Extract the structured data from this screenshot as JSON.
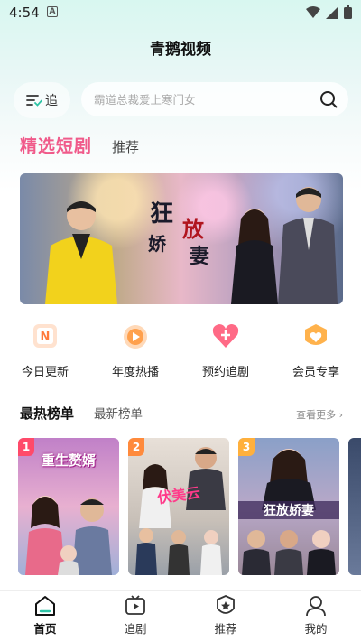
{
  "status": {
    "time": "4:54",
    "notif_glyph": "A"
  },
  "app": {
    "title": "青鹅视频"
  },
  "header": {
    "follow_label": "追",
    "search_placeholder": "霸道总裁爱上寒门女"
  },
  "tabs": [
    {
      "label": "精选短剧",
      "active": true
    },
    {
      "label": "推荐",
      "active": false
    }
  ],
  "banner": {
    "title_chars": [
      "狂",
      "娇",
      "放",
      "妻"
    ]
  },
  "quick_links": [
    {
      "label": "今日更新",
      "icon": "n-calendar-icon",
      "color": "#ff8a4c"
    },
    {
      "label": "年度热播",
      "icon": "play-icon",
      "color": "#ff9a3c"
    },
    {
      "label": "预约追剧",
      "icon": "heart-plus-icon",
      "color": "#ff5a7a"
    },
    {
      "label": "会员专享",
      "icon": "crown-heart-icon",
      "color": "#ffa23c"
    }
  ],
  "ranking": {
    "tabs": [
      {
        "label": "最热榜单",
        "active": true
      },
      {
        "label": "最新榜单",
        "active": false
      }
    ],
    "see_more": "查看更多 ›",
    "cards": [
      {
        "rank": "1",
        "badge_color": "#ff4a6a",
        "poster_title": "重生赘婿",
        "poster_color": "#ffffff",
        "bg": "#b87ab8"
      },
      {
        "rank": "2",
        "badge_color": "#ff8a3c",
        "poster_title": "伏美云",
        "poster_color": "#ff4a9a",
        "bg": "#d8c8c0"
      },
      {
        "rank": "3",
        "badge_color": "#ffb03c",
        "poster_title": "狂放娇妻",
        "poster_color": "#ffffff",
        "bg": "#8aa0c0"
      }
    ]
  },
  "bottom_nav": [
    {
      "label": "首页",
      "icon": "home-icon",
      "active": true
    },
    {
      "label": "追剧",
      "icon": "play-box-icon",
      "active": false
    },
    {
      "label": "推荐",
      "icon": "star-badge-icon",
      "active": false
    },
    {
      "label": "我的",
      "icon": "user-icon",
      "active": false
    }
  ],
  "colors": {
    "accent": "#f05a8a",
    "bg_top": "#d8f7f0"
  }
}
